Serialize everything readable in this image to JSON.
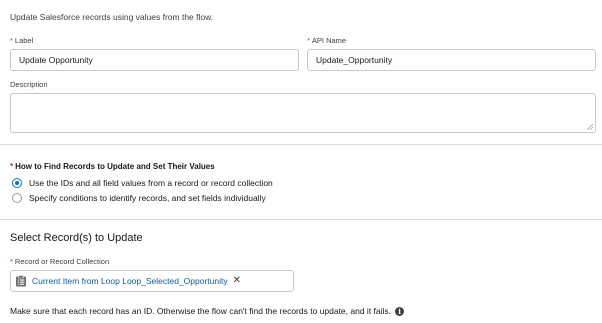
{
  "intro_text": "Update Salesforce records using values from the flow.",
  "label_field": {
    "required_mark": "*",
    "label": "Label",
    "value": "Update Opportunity"
  },
  "api_name_field": {
    "required_mark": "*",
    "label": "API Name",
    "value": "Update_Opportunity"
  },
  "description_field": {
    "label": "Description",
    "value": ""
  },
  "find_records": {
    "required_mark": "*",
    "label": "How to Find Records to Update and Set Their Values",
    "options": [
      {
        "label": "Use the IDs and all field values from a record or record collection",
        "selected": true
      },
      {
        "label": "Specify conditions to identify records, and set fields individually",
        "selected": false
      }
    ]
  },
  "select_section": {
    "heading": "Select Record(s) to Update",
    "record_field": {
      "required_mark": "*",
      "label": "Record or Record Collection",
      "pill_icon": "record-collection-icon",
      "pill_value": "Current Item from Loop Loop_Selected_Opportunity",
      "remove_icon": "close-icon"
    }
  },
  "footnote": "Make sure that each record has an ID. Otherwise the flow can't find the records to update, and it fails.",
  "colors": {
    "accent": "#0176d3",
    "link": "#0b5cab",
    "required": "#c23934",
    "border": "#c9c9c9"
  }
}
